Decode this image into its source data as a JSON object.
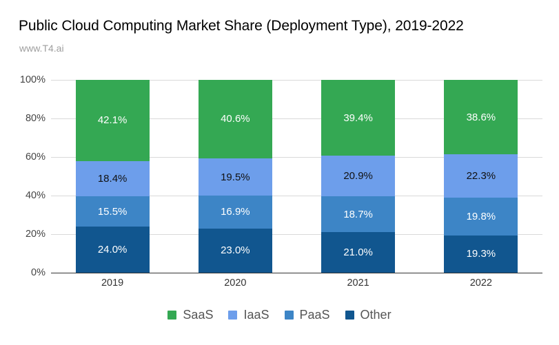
{
  "chart_data": {
    "type": "bar",
    "subtype": "stacked-bar-100",
    "title": "Public Cloud Computing Market Share (Deployment Type), 2019-2022",
    "subtitle": "www.T4.ai",
    "xlabel": "",
    "ylabel": "",
    "categories": [
      "2019",
      "2020",
      "2021",
      "2022"
    ],
    "ylim": [
      0,
      100
    ],
    "ytick_labels": [
      "0%",
      "20%",
      "40%",
      "60%",
      "80%",
      "100%"
    ],
    "ytick_values": [
      0,
      20,
      40,
      60,
      80,
      100
    ],
    "grid": true,
    "legend_position": "bottom",
    "stack_order_bottom_to_top": [
      "Other",
      "PaaS",
      "IaaS",
      "SaaS"
    ],
    "series": [
      {
        "name": "SaaS",
        "color": "#34a853",
        "label_color": "#ffffff",
        "values": [
          42.1,
          40.6,
          39.4,
          38.6
        ],
        "value_labels": [
          "42.1%",
          "40.6%",
          "39.4%",
          "38.6%"
        ]
      },
      {
        "name": "IaaS",
        "color": "#6d9eeb",
        "label_color": "#111111",
        "values": [
          18.4,
          19.5,
          20.9,
          22.3
        ],
        "value_labels": [
          "18.4%",
          "19.5%",
          "20.9%",
          "22.3%"
        ]
      },
      {
        "name": "PaaS",
        "color": "#3d85c6",
        "label_color": "#ffffff",
        "values": [
          15.5,
          16.9,
          18.7,
          19.8
        ],
        "value_labels": [
          "15.5%",
          "16.9%",
          "18.7%",
          "19.8%"
        ]
      },
      {
        "name": "Other",
        "color": "#11568f",
        "label_color": "#ffffff",
        "values": [
          24.0,
          23.0,
          21.0,
          19.3
        ],
        "value_labels": [
          "24.0%",
          "23.0%",
          "21.0%",
          "19.3%"
        ]
      }
    ]
  }
}
